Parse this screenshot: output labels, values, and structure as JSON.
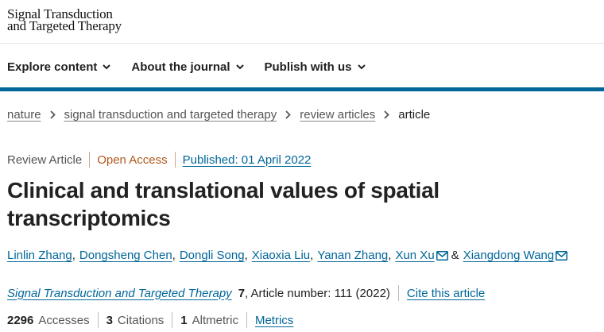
{
  "logo": {
    "line1": "Signal Transduction",
    "line2": "and Targeted Therapy"
  },
  "nav": {
    "items": [
      {
        "label": "Explore content"
      },
      {
        "label": "About the journal"
      },
      {
        "label": "Publish with us"
      }
    ]
  },
  "breadcrumb": {
    "items": [
      "nature",
      "signal transduction and targeted therapy",
      "review articles"
    ],
    "current": "article"
  },
  "meta": {
    "type": "Review Article",
    "access": "Open Access",
    "published": "Published: 01 April 2022"
  },
  "article": {
    "title": "Clinical and translational values of spatial transcriptomics"
  },
  "authors": {
    "names": [
      "Linlin Zhang",
      "Dongsheng Chen",
      "Dongli Song",
      "Xiaoxia Liu",
      "Yanan Zhang",
      "Xun Xu",
      "Xiangdong Wang"
    ],
    "conjunction": "&"
  },
  "citation": {
    "journal": "Signal Transduction and Targeted Therapy",
    "volume": "7",
    "article_number": ", Article number: 111 (2022)",
    "cite_label": "Cite this article"
  },
  "metrics": {
    "accesses_count": "2296",
    "accesses_label": "Accesses",
    "citations_count": "3",
    "citations_label": "Citations",
    "altmetric_count": "1",
    "altmetric_label": "Altmetric",
    "metrics_link": "Metrics"
  },
  "colors": {
    "brand_blue": "#006699",
    "open_access": "#b1581b",
    "text": "#222222"
  },
  "icons": [
    "chevron-down-icon",
    "chevron-right-icon",
    "envelope-icon"
  ]
}
